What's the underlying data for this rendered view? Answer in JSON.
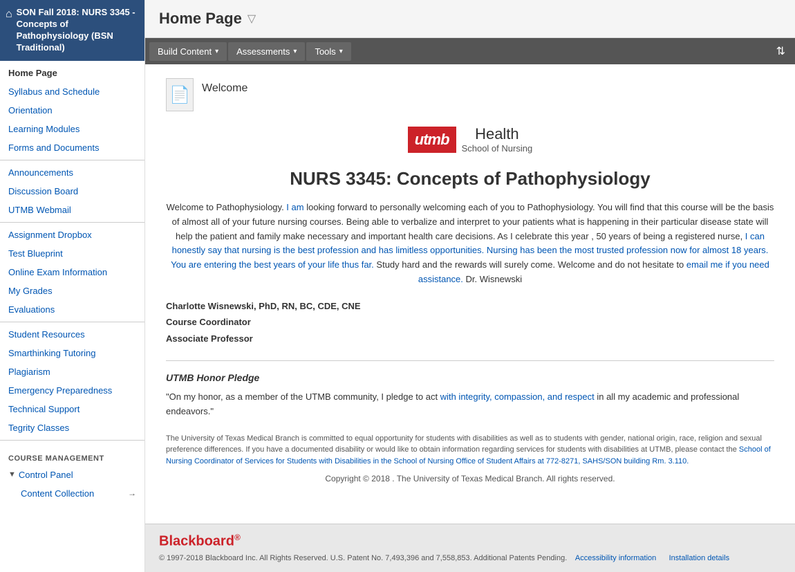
{
  "sidebar": {
    "course_title": "SON Fall 2018: NURS 3345 - Concepts of Pathophysiology (BSN Traditional)",
    "nav_items_top": [
      {
        "label": "Home Page",
        "active": true
      },
      {
        "label": "Syllabus and Schedule",
        "active": false
      },
      {
        "label": "Orientation",
        "active": false
      },
      {
        "label": "Learning Modules",
        "active": false
      },
      {
        "label": "Forms and Documents",
        "active": false
      }
    ],
    "nav_items_mid1": [
      {
        "label": "Announcements"
      },
      {
        "label": "Discussion Board"
      },
      {
        "label": "UTMB Webmail"
      }
    ],
    "nav_items_mid2": [
      {
        "label": "Assignment Dropbox"
      },
      {
        "label": "Test Blueprint"
      },
      {
        "label": "Online Exam Information"
      },
      {
        "label": "My Grades"
      },
      {
        "label": "Evaluations"
      }
    ],
    "nav_items_mid3": [
      {
        "label": "Student Resources"
      },
      {
        "label": "Smarthinking Tutoring"
      },
      {
        "label": "Plagiarism"
      },
      {
        "label": "Emergency Preparedness"
      },
      {
        "label": "Technical Support"
      },
      {
        "label": "Tegrity Classes"
      }
    ],
    "course_management_label": "COURSE MANAGEMENT",
    "control_panel_label": "Control Panel",
    "content_collection_label": "Content Collection"
  },
  "header": {
    "title": "Home Page"
  },
  "toolbar": {
    "build_content_label": "Build Content",
    "assessments_label": "Assessments",
    "tools_label": "Tools"
  },
  "content": {
    "welcome_label": "Welcome",
    "utmb_box": "utmb",
    "utmb_health": "Health",
    "utmb_school": "School of Nursing",
    "course_title": "NURS 3345: Concepts of Pathophysiology",
    "welcome_text": "Welcome to Pathophysiology. I am looking forward to personally welcoming each of you to Pathophysiology. You will find that this course will be the basis of almost all of your future nursing courses. Being able to verbalize and interpret to your patients what is happening in their particular disease state will help the patient and family make necessary and important health care decisions. As I celebrate this year , 50 years of being a registered nurse, I can honestly say that nursing is the best profession and has limitless opportunities. Nursing has been the most trusted profession now for almost 18 years. You are entering the best years of your life thus far. Study hard and the rewards will surely come.  Welcome and do not hesitate to email me if you need assistance. Dr. Wisnewski",
    "instructor_name": "Charlotte Wisnewski, PhD, RN, BC, CDE, CNE",
    "instructor_role": "Course Coordinator",
    "instructor_title": "Associate Professor",
    "honor_pledge_title": "UTMB Honor Pledge",
    "honor_pledge_text": "\"On my honor, as a member of the UTMB community, I pledge to act with integrity, compassion, and respect in all my academic and professional endeavors.\"",
    "accessibility_text": "The University of Texas Medical Branch is committed to equal opportunity for students with disabilities as well as to students with gender, national origin, race, religion and sexual preference differences. If you have a documented disability or would like to obtain information regarding services for students with disabilities at UTMB, please contact the School of Nursing Coordinator of Services for Students with Disabilities in the School of Nursing Office of Student Affairs at 772-8271, SAHS/SON building Rm. 3.110.",
    "copyright_text": "Copyright © 2018 . The University of Texas Medical Branch. All rights reserved."
  },
  "footer": {
    "bb_logo": "Blackboard",
    "bb_trademark": "®",
    "bb_copyright": "© 1997-2018 Blackboard Inc. All Rights Reserved. U.S. Patent No. 7,493,396 and 7,558,853. Additional Patents Pending.",
    "accessibility_link": "Accessibility information",
    "installation_link": "Installation details"
  },
  "colors": {
    "sidebar_header_bg": "#2c4f7c",
    "toolbar_bg": "#555555",
    "link_color": "#0056b3",
    "utmb_red": "#cc2229"
  }
}
